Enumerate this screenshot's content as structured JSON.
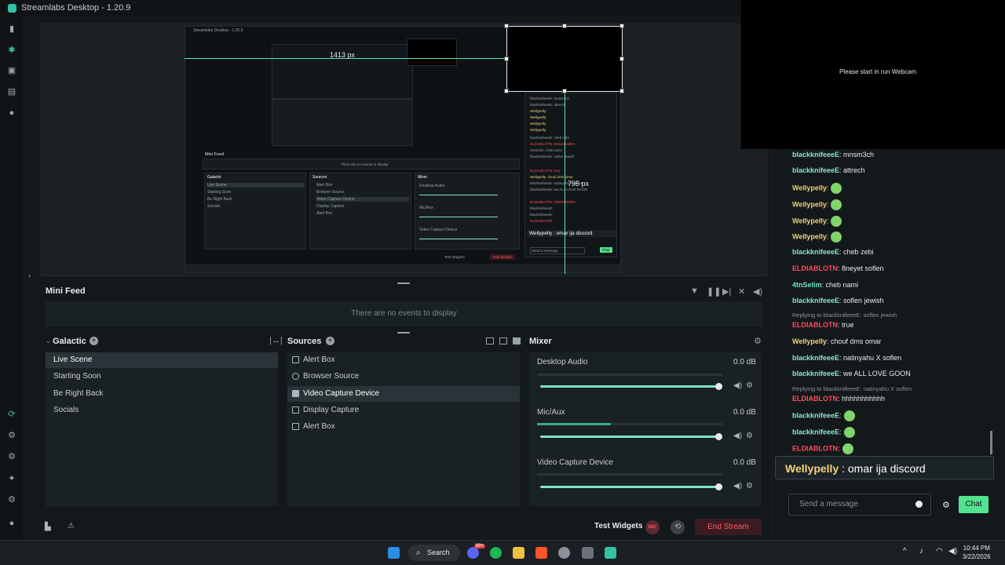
{
  "app": {
    "title": "Streamlabs Desktop - 1.20.9"
  },
  "preview": {
    "nested_title": "Streamlabs Desktop - 1.20.9",
    "px_horizontal": "1413 px",
    "px_vertical": "795 px",
    "nested_minifeed": "Mini Feed",
    "nested_no_events": "There are no events to display",
    "nested_chat_pinned": "Wellypelly : omar ija discord",
    "nested_send": "Send a message",
    "nested_chat_btn": "Chat",
    "nested_end_stream": "End Stream",
    "nested_test_widgets": "Test Widgets",
    "nested_scene_header": "Galactic",
    "nested_sources_header": "Sources",
    "nested_mixer_header": "Mixer",
    "nested_scenes": [
      "Live Scene",
      "Starting Soon",
      "Be Right Back",
      "Socials"
    ],
    "nested_sources": [
      "Alert Box",
      "Browser Source",
      "Video Capture Device",
      "Display Capture",
      "Alert Box"
    ],
    "nested_mixer": [
      "Desktop Audio",
      "Mic/Aux",
      "Video Capture Device"
    ],
    "nested_mixer_db": "0.0 dB",
    "nested_chat": [
      "blackknifeeeE: mnsm3ch",
      "blackknifeeeE: attrech",
      "Wellypelly:",
      "Wellypelly:",
      "Wellypelly:",
      "Wellypelly:",
      "blackknifeeeE: cheb zebi",
      "ELDIABLOTN: 8neyet soflen",
      "4tnSelim: cheb nami",
      "blackknifeeeE: soflen jewish",
      "ELDIABLOTN: true",
      "Wellypelly: chouf dms omar",
      "blackknifeeeE: natinyahu X soflen",
      "blackknifeeeE: we ALL LOVE GOON",
      "ELDIABLOTN: hhhhhhhhhhh",
      "blackknifeeeE:",
      "blackknifeeeE:",
      "ELDIABLOTN:"
    ]
  },
  "popup": {
    "text": "Please start in run Webcam"
  },
  "minifeed": {
    "title": "Mini Feed",
    "empty": "There are no events to display"
  },
  "scenes": {
    "collection": "Galactic",
    "items": [
      "Live Scene",
      "Starting Soon",
      "Be Right Back",
      "Socials"
    ],
    "active_index": 0
  },
  "sources": {
    "title": "Sources",
    "items": [
      "Alert Box",
      "Browser Source",
      "Video Capture Device",
      "Display Capture",
      "Alert Box"
    ],
    "active_index": 2
  },
  "mixer": {
    "title": "Mixer",
    "channels": [
      {
        "name": "Desktop Audio",
        "db": "0.0 dB",
        "level": 0.0,
        "volume": 1.0
      },
      {
        "name": "Mic/Aux",
        "db": "0.0 dB",
        "level": 0.4,
        "volume": 1.0
      },
      {
        "name": "Video Capture Device",
        "db": "0.0 dB",
        "level": 0.0,
        "volume": 1.0
      }
    ]
  },
  "footer": {
    "test_widgets": "Test Widgets",
    "rec": "REC",
    "end_stream": "End Stream"
  },
  "chat": {
    "messages": [
      {
        "user": "blackknifeeeE",
        "text": ": mnsm3ch",
        "color": "#8be6c8"
      },
      {
        "user": "blackknifeeeE",
        "text": ": attrech",
        "color": "#8be6c8"
      },
      {
        "user": "Wellypelly",
        "text": ":",
        "color": "#f3d27a",
        "emote": true
      },
      {
        "user": "Wellypelly",
        "text": ":",
        "color": "#f3d27a",
        "emote": true
      },
      {
        "user": "Wellypelly",
        "text": ":",
        "color": "#f3d27a",
        "emote": true
      },
      {
        "user": "Wellypelly",
        "text": ":",
        "color": "#f3d27a",
        "emote": true
      },
      {
        "user": "blackknifeeeE",
        "text": ": cheb zebi",
        "color": "#8be6c8"
      },
      {
        "user": "ELDIABLOTN",
        "text": ": 8neyet soflen",
        "color": "#ff4d5e"
      },
      {
        "user": "4tnSelim",
        "text": ": cheb nami",
        "color": "#6fe3c0"
      },
      {
        "user": "blackknifeeeE",
        "text": ": soflen jewish",
        "color": "#8be6c8"
      },
      {
        "reply": "Replying to blackknifeeeE: soflen jewish"
      },
      {
        "user": "ELDIABLOTN",
        "text": ": true",
        "color": "#ff4d5e"
      },
      {
        "user": "Wellypelly",
        "text": ": chouf dms omar",
        "color": "#f3d27a"
      },
      {
        "user": "blackknifeeeE",
        "text": ": natinyahu X soflen",
        "color": "#8be6c8"
      },
      {
        "user": "blackknifeeeE",
        "text": ": we ALL LOVE GOON",
        "color": "#8be6c8"
      },
      {
        "reply": "Replying to blackknifeeeE: natinyahu X soflen"
      },
      {
        "user": "ELDIABLOTN",
        "text": ": hhhhhhhhhhh",
        "color": "#ff4d5e"
      },
      {
        "user": "blackknifeeeE",
        "text": ":",
        "color": "#8be6c8",
        "emote": true
      },
      {
        "user": "blackknifeeeE",
        "text": ":",
        "color": "#8be6c8",
        "emote": true
      },
      {
        "user": "ELDIABLOTN",
        "text": ":",
        "color": "#ff4d5e",
        "emote": true
      }
    ],
    "pinned_user": "Wellypelly",
    "pinned_text": " : omar ija discord",
    "input_placeholder": "Send a message",
    "send_label": "Chat"
  },
  "taskbar": {
    "search": "Search",
    "time": "10:44 PM",
    "date": "3/22/2026",
    "apps": [
      "windows-start-icon",
      "discord-icon",
      "spotify-icon",
      "file-explorer-icon",
      "brave-icon",
      "settings-icon",
      "app-icon",
      "streamlabs-icon"
    ],
    "badge": "99+"
  }
}
